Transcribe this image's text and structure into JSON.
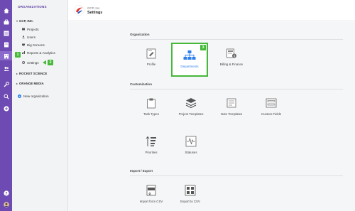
{
  "rail": {
    "icons": [
      "home-icon",
      "briefcase-icon",
      "list-icon",
      "building-icon",
      "users-icon",
      "wrench-icon",
      "search-icon",
      "plus-circle-icon",
      "help-icon",
      "avatar"
    ]
  },
  "sidebar": {
    "heading": "ORGANIZATIONS",
    "orgs": [
      {
        "name": "GCP, INC.",
        "expanded": true
      },
      {
        "name": "ROCKET SCIENCE",
        "expanded": false
      },
      {
        "name": "ORANGE MEDIA",
        "expanded": false
      }
    ],
    "items": [
      {
        "label": "Projects",
        "icon": "folder-icon"
      },
      {
        "label": "Users",
        "icon": "users-icon"
      },
      {
        "label": "Big Screens",
        "icon": "screen-icon"
      },
      {
        "label": "Reports & Analytics",
        "icon": "chart-icon"
      },
      {
        "label": "Settings",
        "icon": "gear-icon"
      }
    ],
    "new_org": "New organization"
  },
  "callouts": {
    "one": "1",
    "two": "2",
    "three": "3"
  },
  "header": {
    "company": "GCP, Inc.",
    "title": "Settings"
  },
  "sections": {
    "organization": {
      "title": "Organization",
      "tiles": [
        "Profile",
        "Departments",
        "Billing & Finance"
      ]
    },
    "customization": {
      "title": "Customization",
      "tiles": [
        "Task Types",
        "Project Templates",
        "Note Templates",
        "Custom Fields",
        "Priorities",
        "Statuses"
      ]
    },
    "import_export": {
      "title": "Import / Export",
      "tiles": [
        "Import from CSV",
        "Export to CSV"
      ]
    }
  },
  "colors": {
    "rail": "#6e4ab3",
    "highlight": "#46b83a",
    "accent": "#2f80ed"
  }
}
